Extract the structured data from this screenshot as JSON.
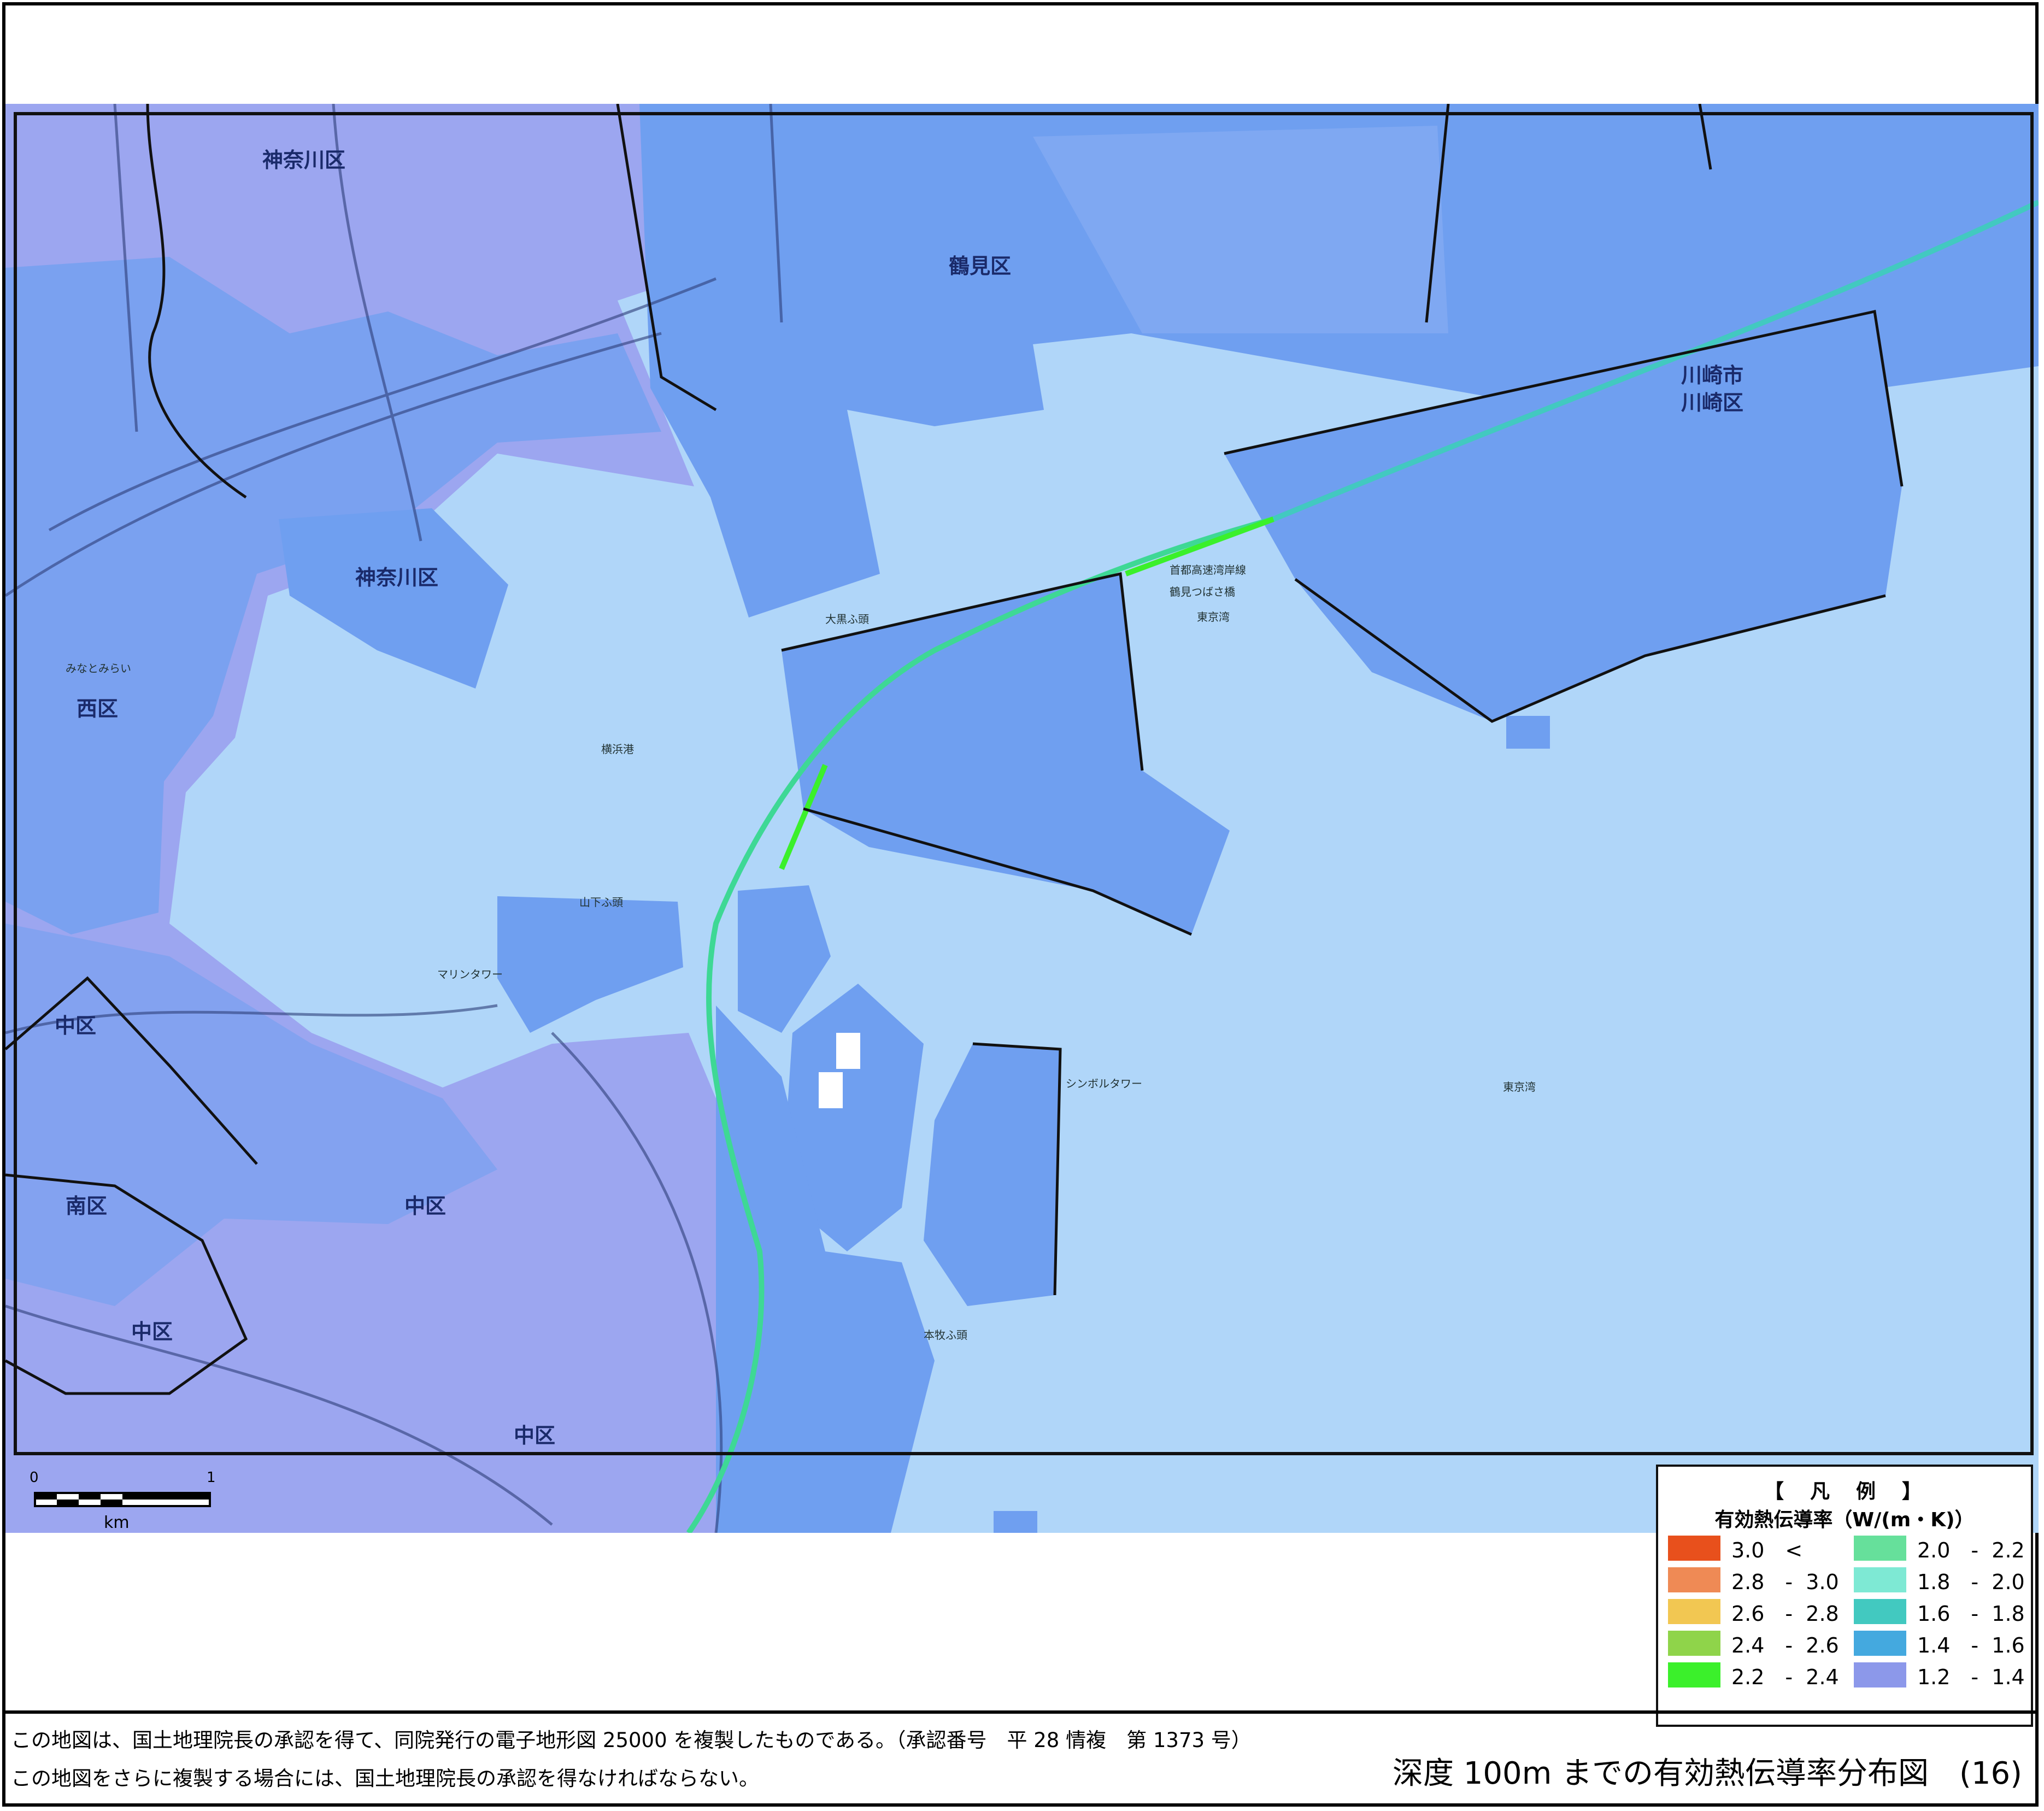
{
  "map": {
    "ward_labels": [
      "神奈川区",
      "神奈川区",
      "鶴見区",
      "西区",
      "中区",
      "南区",
      "中区",
      "中区",
      "中区",
      "川崎市",
      "川崎区"
    ],
    "place_labels": [
      "横浜港",
      "東京湾",
      "東京湾",
      "首都高速湾岸線",
      "マリンタワー",
      "シンボルタワー",
      "山下ふ頭",
      "本牧ふ頭",
      "大黒ふ頭",
      "みなとみらい",
      "鶴見つばさ橋"
    ],
    "colors": {
      "water": "#b0d6f9",
      "land_urban": "#9ca6f0",
      "land_blue": "#6f9ff0",
      "land_strong": "#4f86ee",
      "road": "#2d3d78",
      "boundary": "#111111",
      "highway": "#2fd080"
    }
  },
  "scale_bar": {
    "zero": "0",
    "one": "1",
    "unit": "km"
  },
  "legend": {
    "title": "【　凡　例　】",
    "subtitle": "有効熱伝導率（W/(m・K)）",
    "items": [
      {
        "label": "3.0　<",
        "color": "#e8501c"
      },
      {
        "label": "2.8　-  3.0",
        "color": "#ef8a55"
      },
      {
        "label": "2.6　-  2.8",
        "color": "#f2c752"
      },
      {
        "label": "2.4　-  2.6",
        "color": "#8fd44a"
      },
      {
        "label": "2.2　-  2.4",
        "color": "#3bf02b"
      },
      {
        "label": "2.0　-  2.2",
        "color": "#66e09b"
      },
      {
        "label": "1.8　-  2.0",
        "color": "#7ee9d4"
      },
      {
        "label": "1.6　-  1.8",
        "color": "#42c9c0"
      },
      {
        "label": "1.4　-  1.6",
        "color": "#44a9df"
      },
      {
        "label": "1.2　-  1.4",
        "color": "#8c98ea"
      }
    ]
  },
  "footer": {
    "note1": "この地図は、国土地理院長の承認を得て、同院発行の電子地形図 25000 を複製したものである。（承認番号　平 28 情複　第 1373 号）",
    "note2": "この地図をさらに複製する場合には、国土地理院長の承認を得なければならない。",
    "caption": "深度 100m までの有効熱伝導率分布図　(16)"
  }
}
